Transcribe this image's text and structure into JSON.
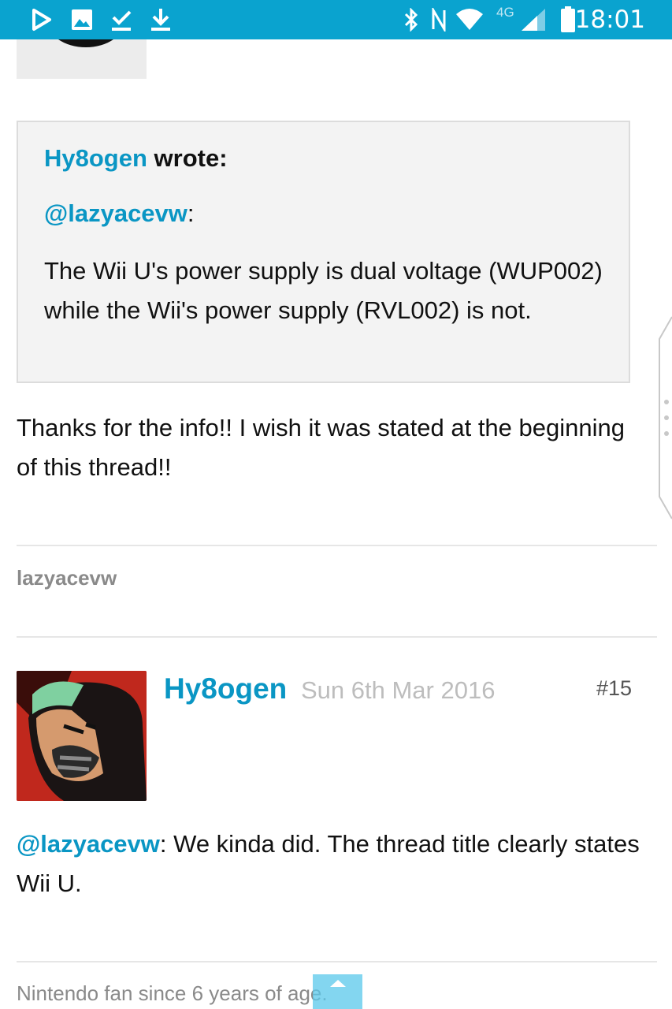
{
  "status_bar": {
    "left_icons": [
      "play-store-icon",
      "image-icon",
      "download-done-icon",
      "download-icon"
    ],
    "right_icons": [
      "bluetooth-icon",
      "nfc-icon",
      "wifi-icon",
      "signal-icon",
      "battery-icon"
    ],
    "network": "4G",
    "time": "18:01",
    "color": "#0aa3cf"
  },
  "quote": {
    "author": "Hy8ogen",
    "wrote": "wrote:",
    "mention": "@lazyacevw",
    "colon": ":",
    "body": "The Wii U's power supply is dual voltage (WUP002) while the Wii's power supply (RVL002) is not."
  },
  "post1": {
    "text": "Thanks for the info!! I wish it was stated at the beginning of this thread!!",
    "signature": "lazyacevw"
  },
  "post2": {
    "author": "Hy8ogen",
    "date": "Sun 6th Mar 2016",
    "number": "#15",
    "mention": "@lazyacevw",
    "text": ": We kinda did. The thread title clearly states Wii U.",
    "signature": "Nintendo fan since 6 years of age."
  },
  "accent_color": "#0a96c4"
}
